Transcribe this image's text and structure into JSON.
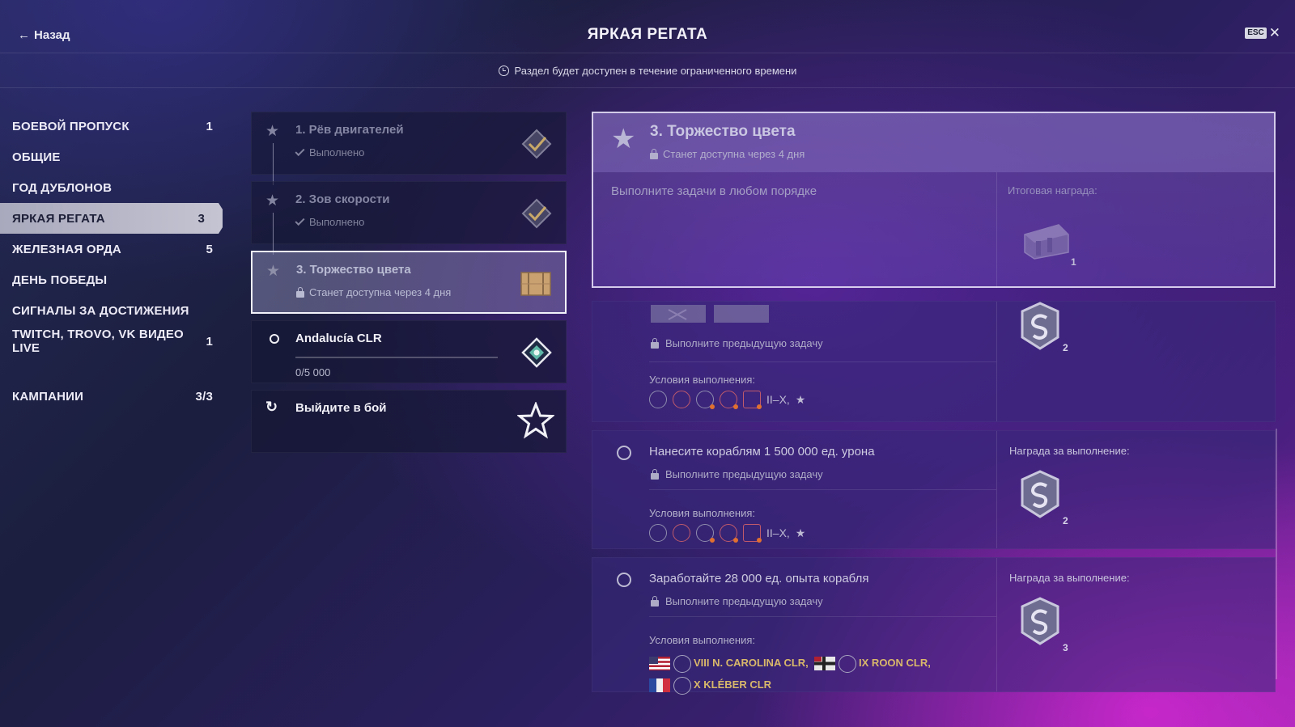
{
  "header": {
    "back_label": "Назад",
    "title": "ЯРКАЯ РЕГАТА",
    "esc_label": "ESC",
    "close_glyph": "✕"
  },
  "notice": {
    "text": "Раздел будет доступен в течение ограниченного времени",
    "icon": "clock-icon"
  },
  "sidebar": {
    "items": [
      {
        "label": "БОЕВОЙ ПРОПУСК",
        "count": "1"
      },
      {
        "label": "ОБЩИЕ",
        "count": ""
      },
      {
        "label": "ГОД ДУБЛОНОВ",
        "count": ""
      },
      {
        "label": "ЯРКАЯ РЕГАТА",
        "count": "3",
        "active": true
      },
      {
        "label": "ЖЕЛЕЗНАЯ ОРДА",
        "count": "5"
      },
      {
        "label": "ДЕНЬ ПОБЕДЫ",
        "count": ""
      },
      {
        "label": "СИГНАЛЫ ЗА ДОСТИЖЕНИЯ",
        "count": ""
      },
      {
        "label": "TWITCH, TROVO, VK ВИДЕО LIVE",
        "count": "1"
      }
    ],
    "campaigns": {
      "label": "КАМПАНИИ",
      "count": "3/3"
    }
  },
  "steps": [
    {
      "name": "1. Рёв двигателей",
      "status": "Выполнено"
    },
    {
      "name": "2. Зов скорости",
      "status": "Выполнено"
    },
    {
      "name": "3. Торжество цвета",
      "status": "Станет доступна через 4 дня"
    },
    {
      "name": "Andalucía CLR",
      "progress_text": "0/5 000",
      "progress": 0
    },
    {
      "name": "Выйдите в бой"
    }
  ],
  "detail": {
    "title": "3. Торжество цвета",
    "availability": "Станет доступна через 4 дня",
    "task_hint": "Выполните задачи в любом порядке",
    "final_reward_label": "Итоговая награда:",
    "final_reward_count": "1",
    "cards": [
      {
        "lock_text": "Выполните предыдущую задачу",
        "conditions_label": "Условия выполнения:",
        "tiers": "II–X,",
        "reward_count": "2"
      },
      {
        "title": "Нанесите кораблям 1 500 000 ед. урона",
        "lock_text": "Выполните предыдущую задачу",
        "conditions_label": "Условия выполнения:",
        "tiers": "II–X,",
        "reward_label": "Награда за выполнение:",
        "reward_count": "2"
      },
      {
        "title": "Заработайте 28 000 ед. опыта корабля",
        "lock_text": "Выполните предыдущую задачу",
        "conditions_label": "Условия выполнения:",
        "ship1": "VIII N. CAROLINA CLR,",
        "ship2": "IX ROON CLR,",
        "ship3": "X KLÉBER CLR",
        "reward_label": "Награда за выполнение:",
        "reward_count": "3"
      }
    ]
  },
  "colors": {
    "accent_gold": "#d9b86a",
    "active_tab": "#bcbccc",
    "selected_border": "#f2f2fb"
  }
}
